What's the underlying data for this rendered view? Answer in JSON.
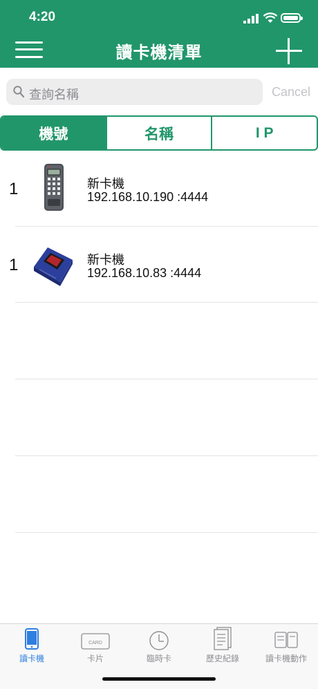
{
  "status_bar": {
    "time": "4:20"
  },
  "header": {
    "title": "讀卡機清單"
  },
  "search": {
    "placeholder": "查詢名稱",
    "cancel_label": "Cancel"
  },
  "segments": [
    {
      "label": "機號",
      "selected": true
    },
    {
      "label": "名稱",
      "selected": false
    },
    {
      "label": "I P",
      "selected": false
    }
  ],
  "readers": [
    {
      "number": "1",
      "name": "新卡機",
      "address": "192.168.10.190 :4444",
      "device_icon": "keypad-reader-icon"
    },
    {
      "number": "1",
      "name": "新卡機",
      "address": "192.168.10.83 :4444",
      "device_icon": "blue-controller-icon"
    }
  ],
  "tabs": [
    {
      "label": "讀卡機",
      "icon": "phone-icon",
      "selected": true
    },
    {
      "label": "卡片",
      "icon": "card-icon",
      "card_text": "CARD",
      "selected": false
    },
    {
      "label": "臨時卡",
      "icon": "clock-icon",
      "selected": false
    },
    {
      "label": "歷史紀錄",
      "icon": "document-icon",
      "selected": false
    },
    {
      "label": "讀卡機動作",
      "icon": "reader-action-icon",
      "selected": false
    }
  ],
  "colors": {
    "brand_green": "#21966b",
    "tab_active_blue": "#2f7fe0",
    "tab_inactive_gray": "#8e8e93"
  }
}
